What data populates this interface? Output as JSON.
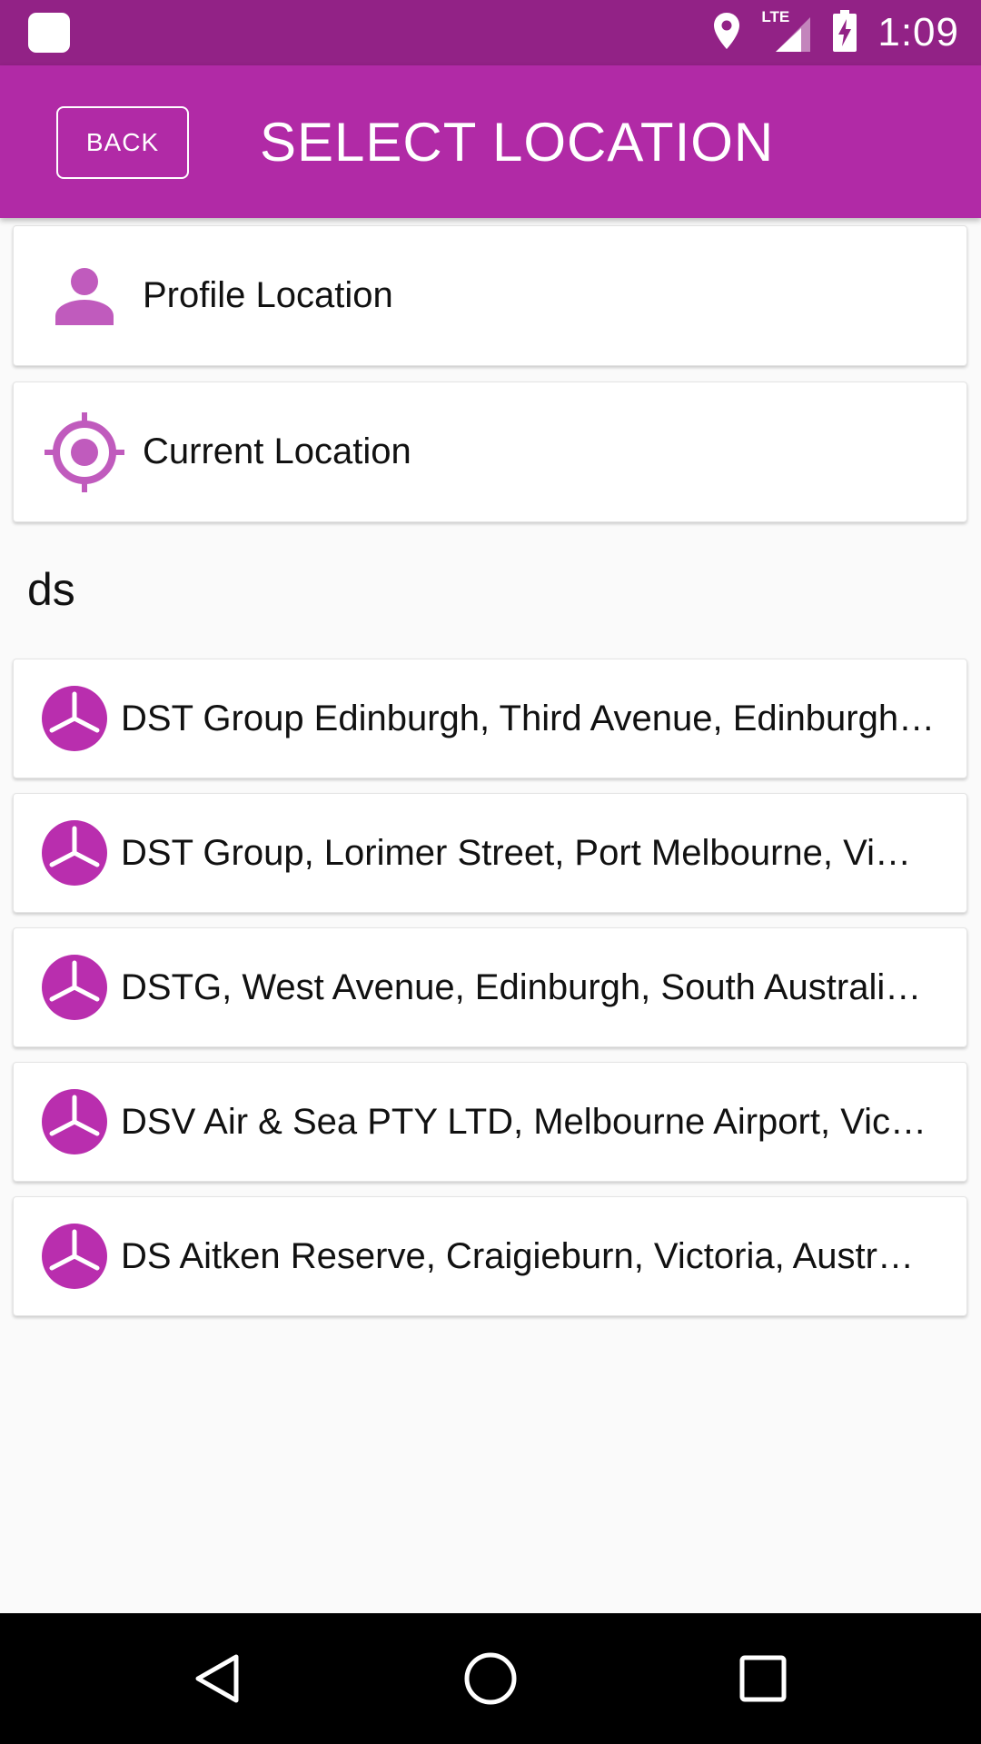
{
  "status_bar": {
    "time": "1:09",
    "network_label": "LTE",
    "icons": [
      "app-notification-icon",
      "location-pin-icon",
      "lte-signal-icon",
      "battery-charging-icon"
    ]
  },
  "app_bar": {
    "back_label": "BACK",
    "title": "SELECT LOCATION"
  },
  "quick_options": [
    {
      "label": "Profile Location",
      "icon": "person-icon"
    },
    {
      "label": "Current Location",
      "icon": "target-icon"
    }
  ],
  "search": {
    "query": "ds"
  },
  "results": [
    {
      "label": "DST Group Edinburgh, Third Avenue, Edinburgh…",
      "icon": "history-clock-icon"
    },
    {
      "label": "DST Group, Lorimer Street, Port Melbourne, Vi…",
      "icon": "history-clock-icon"
    },
    {
      "label": "DSTG, West Avenue, Edinburgh, South Australia…",
      "icon": "history-clock-icon"
    },
    {
      "label": "DSV Air & Sea PTY LTD, Melbourne Airport, Vic…",
      "icon": "history-clock-icon"
    },
    {
      "label": "DS Aitken Reserve, Craigieburn, Victoria, Austr…",
      "icon": "history-clock-icon"
    }
  ],
  "nav_bar": {
    "icons": [
      "back-triangle-icon",
      "home-circle-icon",
      "recents-square-icon"
    ]
  },
  "colors": {
    "status_bar": "#922286",
    "app_bar": "#b12aa6",
    "accent": "#b92eae",
    "icon_light": "#c05bbd",
    "background": "#fafafa"
  }
}
